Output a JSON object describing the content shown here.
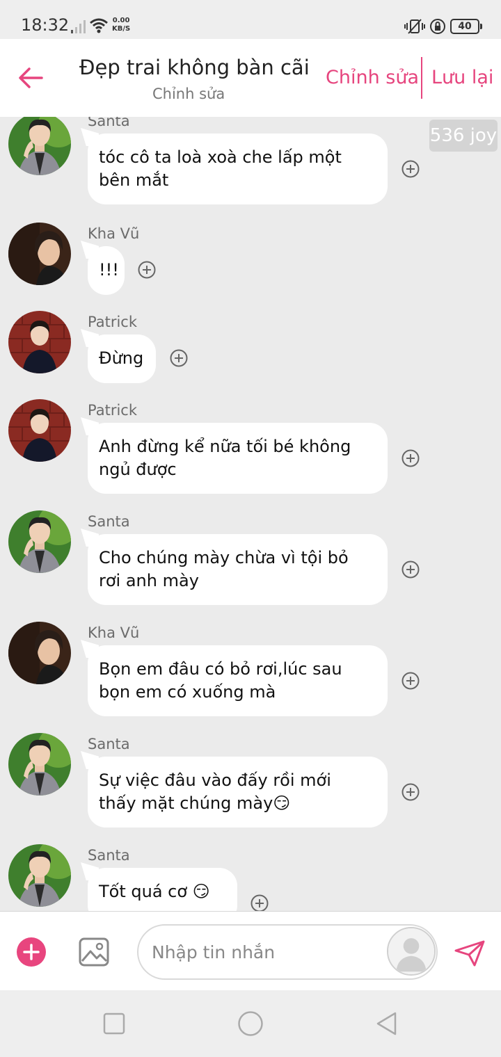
{
  "status_bar": {
    "time": "18:32",
    "net_speed_value": "0.00",
    "net_speed_unit": "KB/S",
    "battery": "40"
  },
  "header": {
    "title": "Đẹp trai không bàn cãi",
    "subtitle": "Chỉnh sửa",
    "edit_label": "Chỉnh sửa",
    "save_label": "Lưu lại",
    "accent_color": "#e6457e"
  },
  "joy_badge": "536 joy",
  "messages": [
    {
      "sender": "Santa",
      "text": "tóc cô ta loà xoà che lấp một\nbên mắt"
    },
    {
      "sender": "Kha Vũ",
      "text": "!!!"
    },
    {
      "sender": "Patrick",
      "text": "Đừng"
    },
    {
      "sender": "Patrick",
      "text": "Anh đừng kể nữa tối bé không\nngủ được"
    },
    {
      "sender": "Santa",
      "text": "Cho chúng mày chừa vì tội bỏ\nrơi anh mày"
    },
    {
      "sender": "Kha Vũ",
      "text": "Bọn em đâu có bỏ rơi,lúc sau\nbọn em có xuống mà"
    },
    {
      "sender": "Santa",
      "text": "Sự việc đâu vào đấy rồi mới\nthấy mặt chúng mày"
    },
    {
      "sender": "Santa",
      "text": "Tốt quá cơ"
    }
  ],
  "input": {
    "placeholder": "Nhập tin nhắn"
  },
  "icons": {
    "back": "arrow-left-icon",
    "add_reaction": "plus-circle-icon",
    "attach": "plus-icon",
    "image": "image-icon",
    "send": "paper-plane-icon",
    "emoji": "smirk-emoji"
  }
}
